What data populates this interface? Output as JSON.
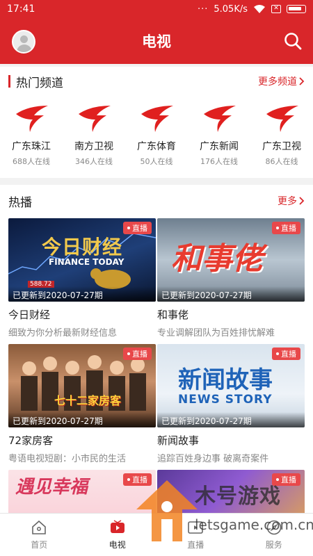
{
  "status_bar": {
    "time": "17:41",
    "dots": "···",
    "speed": "5.05K/s"
  },
  "header": {
    "title": "电视"
  },
  "hot_channels": {
    "title": "热门频道",
    "more_label": "更多频道",
    "items": [
      {
        "name": "广东珠江",
        "viewers": "688人在线"
      },
      {
        "name": "南方卫视",
        "viewers": "346人在线"
      },
      {
        "name": "广东体育",
        "viewers": "50人在线"
      },
      {
        "name": "广东新闻",
        "viewers": "176人在线"
      },
      {
        "name": "广东卫视",
        "viewers": "86人在线"
      }
    ]
  },
  "hot_shows": {
    "title": "热播",
    "more_label": "更多",
    "items": [
      {
        "title": "今日财经",
        "desc": "细致为你分析最新财经信息",
        "badge": "直播",
        "updated": "已更新到2020-07-27期",
        "thumb_text": "今日财经",
        "thumb_subtext": "FINANCE TODAY",
        "thumb_number": "588.72"
      },
      {
        "title": "和事佬",
        "desc": "专业调解团队为百姓排忧解难",
        "badge": "直播",
        "updated": "已更新到2020-07-27期",
        "thumb_text": "和事佬",
        "thumb_subtext": "",
        "thumb_number": ""
      },
      {
        "title": "72家房客",
        "desc": "粤语电视短剧：小市民的生活",
        "badge": "直播",
        "updated": "已更新到2020-07-27期",
        "thumb_text": "七十二家房客",
        "thumb_subtext": "",
        "thumb_number": ""
      },
      {
        "title": "新闻故事",
        "desc": "追踪百姓身边事 破离奇案件",
        "badge": "直播",
        "updated": "已更新到2020-07-27期",
        "thumb_text": "新闻故事",
        "thumb_subtext": "NEWS STORY",
        "thumb_number": ""
      },
      {
        "title": "",
        "desc": "",
        "badge": "直播",
        "updated": "",
        "thumb_text": "遇见幸福",
        "thumb_subtext": "",
        "thumb_number": ""
      },
      {
        "title": "",
        "desc": "",
        "badge": "直播",
        "updated": "",
        "thumb_text": "",
        "thumb_subtext": "",
        "thumb_number": ""
      }
    ]
  },
  "tabbar": {
    "items": [
      {
        "label": "首页",
        "icon": "home-icon"
      },
      {
        "label": "电视",
        "icon": "tv-icon"
      },
      {
        "label": "直播",
        "icon": "live-icon"
      },
      {
        "label": "服务",
        "icon": "compass-icon"
      }
    ]
  },
  "watermark": {
    "title": "木号游戏",
    "url": "letsgame.com.cn"
  },
  "colors": {
    "brand": "#d9262a",
    "live_badge": "#e8484a",
    "muted": "#888888"
  }
}
